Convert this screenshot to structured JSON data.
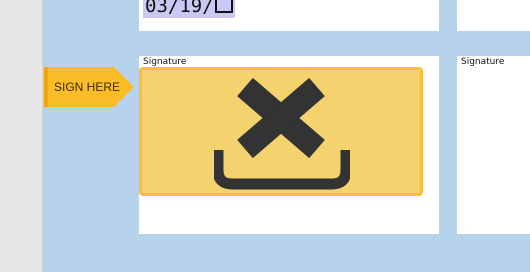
{
  "document": {
    "date_field": {
      "value": "03/19/"
    },
    "signature_labels": [
      "Signature",
      "Signature"
    ],
    "sign_here_tab": {
      "label": "SIGN HERE",
      "color": "#fbbd27"
    },
    "signature_field": {
      "icon": "close-x-tray-icon",
      "fill_color": "#f4d36e",
      "border_color": "#fbbd3b",
      "icon_color": "#333333"
    },
    "canvas_color": "#b6d3eb"
  }
}
